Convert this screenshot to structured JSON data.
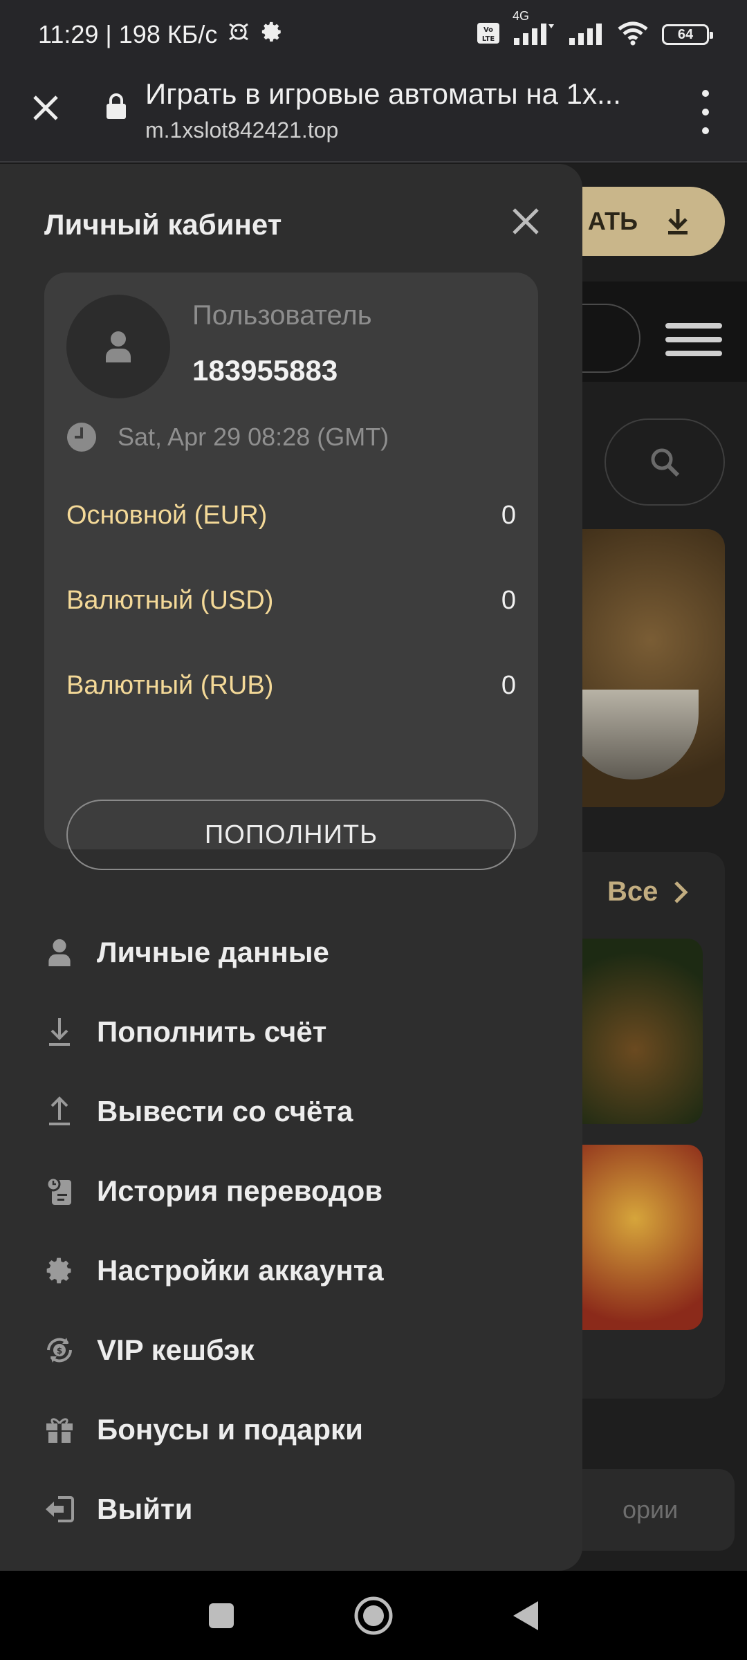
{
  "status_bar": {
    "time_speed": "11:29 | 198 КБ/с",
    "network": "4G",
    "battery": "64"
  },
  "browser": {
    "title": "Играть в игровые автоматы на 1x...",
    "url": "m.1xslot842421.top"
  },
  "background": {
    "download_label": "АТЬ",
    "all_label": "Все",
    "categories_label": "ории"
  },
  "drawer": {
    "title": "Личный кабинет",
    "user_label": "Пользователь",
    "user_id": "183955883",
    "datetime": "Sat, Apr 29 08:28 (GMT)",
    "balances": [
      {
        "name": "Основной (EUR)",
        "value": "0"
      },
      {
        "name": "Валютный (USD)",
        "value": "0"
      },
      {
        "name": "Валютный (RUB)",
        "value": "0"
      }
    ],
    "topup_label": "ПОПОЛНИТЬ",
    "menu": [
      {
        "label": "Личные данные",
        "icon": "person-icon"
      },
      {
        "label": "Пополнить счёт",
        "icon": "download-icon"
      },
      {
        "label": "Вывести со счёта",
        "icon": "upload-icon"
      },
      {
        "label": "История переводов",
        "icon": "history-icon"
      },
      {
        "label": "Настройки аккаунта",
        "icon": "gear-icon"
      },
      {
        "label": "VIP кешбэк",
        "icon": "cashback-icon"
      },
      {
        "label": "Бонусы и подарки",
        "icon": "gift-icon"
      },
      {
        "label": "Выйти",
        "icon": "logout-icon"
      }
    ]
  },
  "colors": {
    "drawer_bg": "#2e2e2e",
    "card_bg": "#3d3d3d",
    "balance_accent": "#f4d998",
    "brand_gold": "#c9b68a"
  }
}
